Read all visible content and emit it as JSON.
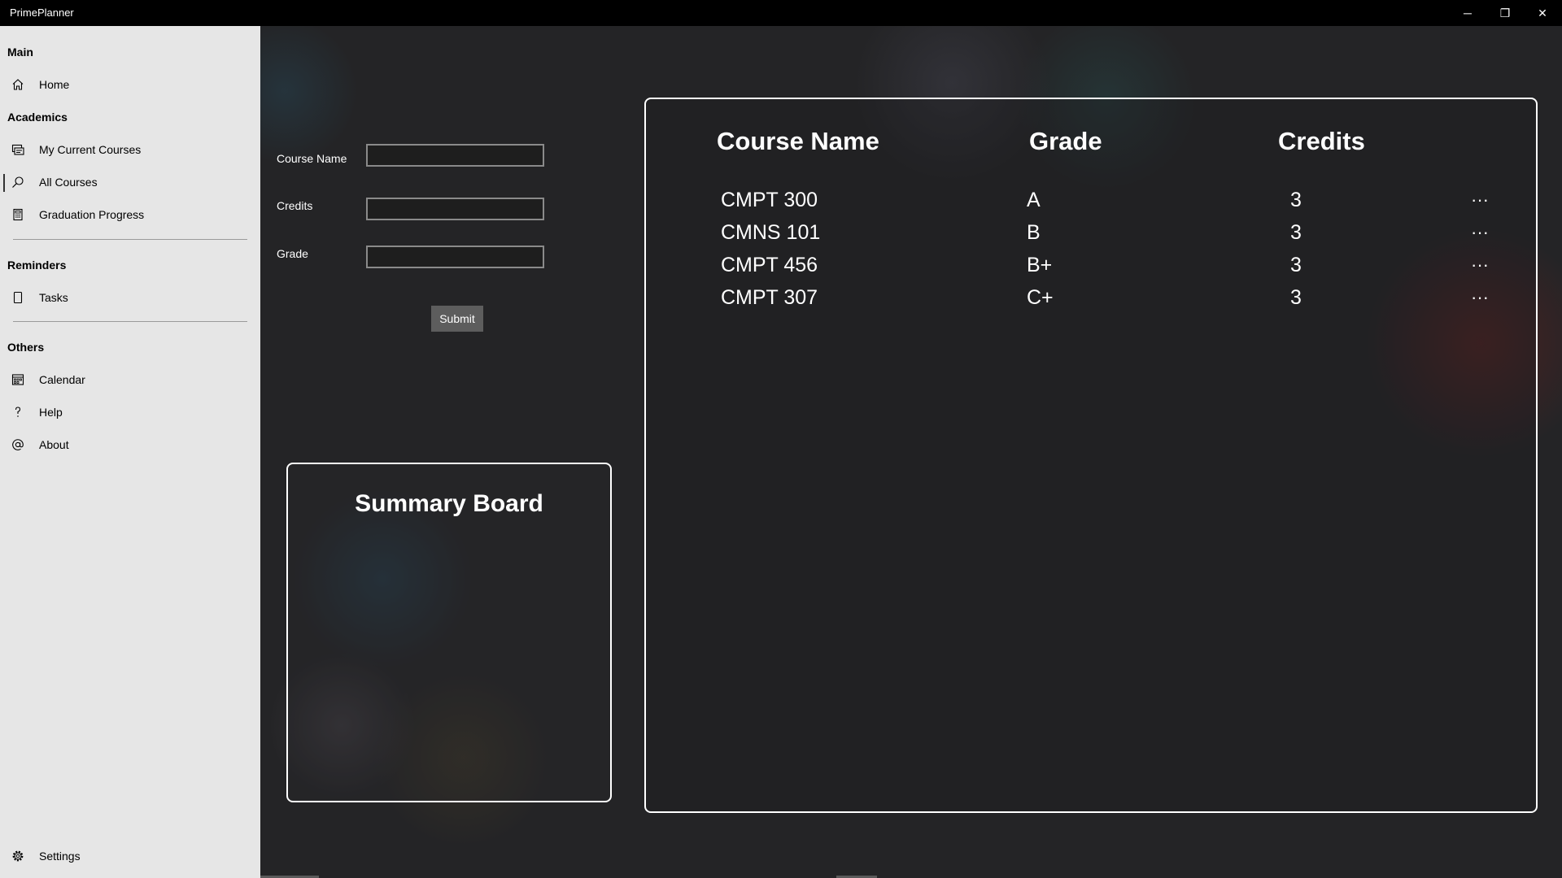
{
  "window": {
    "title": "PrimePlanner",
    "controls": {
      "minimize": "─",
      "restore": "❐",
      "close": "✕"
    }
  },
  "sidebar": {
    "sections": [
      {
        "header": "Main",
        "items": [
          {
            "label": "Home",
            "icon": "home-icon"
          }
        ]
      },
      {
        "header": "Academics",
        "items": [
          {
            "label": "My Current Courses",
            "icon": "courses-icon"
          },
          {
            "label": "All Courses",
            "icon": "search-icon",
            "selected": true
          },
          {
            "label": "Graduation Progress",
            "icon": "calculator-icon"
          }
        ]
      },
      {
        "header": "Reminders",
        "items": [
          {
            "label": "Tasks",
            "icon": "task-icon"
          }
        ]
      },
      {
        "header": "Others",
        "items": [
          {
            "label": "Calendar",
            "icon": "calendar-icon"
          },
          {
            "label": "Help",
            "icon": "help-icon"
          },
          {
            "label": "About",
            "icon": "at-icon"
          }
        ]
      }
    ],
    "settings": {
      "label": "Settings",
      "icon": "gear-icon"
    }
  },
  "form": {
    "course_name_label": "Course Name",
    "credits_label": "Credits",
    "grade_label": "Grade",
    "course_name_value": "",
    "credits_value": "",
    "grade_value": "",
    "submit_label": "Submit"
  },
  "summary": {
    "title": "Summary Board"
  },
  "courses_table": {
    "headers": {
      "course_name": "Course Name",
      "grade": "Grade",
      "credits": "Credits"
    },
    "rows": [
      {
        "course": "CMPT 300",
        "grade": "A",
        "credits": "3",
        "more": "···"
      },
      {
        "course": "CMNS 101",
        "grade": "B",
        "credits": "3",
        "more": "···"
      },
      {
        "course": "CMPT 456",
        "grade": "B+",
        "credits": "3",
        "more": "···"
      },
      {
        "course": "CMPT 307",
        "grade": "C+",
        "credits": "3",
        "more": "···"
      }
    ]
  },
  "colors": {
    "titlebar_bg": "#000000",
    "sidebar_bg": "#e6e6e6",
    "main_bg": "#242426",
    "panel_border": "#ffffff",
    "submit_bg": "#5d5d5d"
  }
}
